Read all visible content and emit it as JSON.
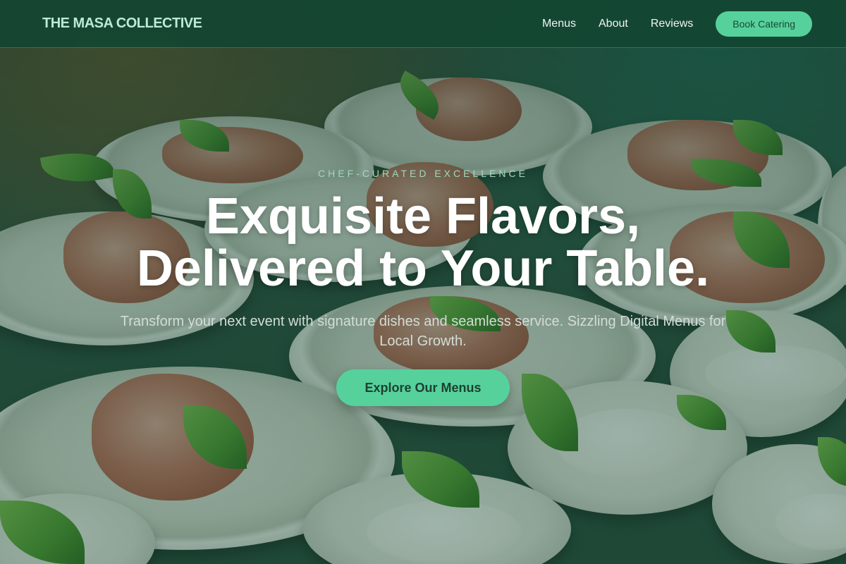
{
  "nav": {
    "brand": "THE MASA COLLECTIVE",
    "links": [
      "Menus",
      "About",
      "Reviews"
    ],
    "cta": "Book Catering"
  },
  "hero": {
    "eyebrow": "CHEF-CURATED EXCELLENCE",
    "headline_line1": "Exquisite Flavors,",
    "headline_line2": "Delivered to Your Table.",
    "subtitle": "Transform your next event with signature dishes and seamless service. Sizzling Digital Menus for Local Growth.",
    "cta": "Explore Our Menus"
  },
  "colors": {
    "accent": "#56d19c",
    "nav_bg": "#144632",
    "brand_text": "#b9ecd4",
    "eyebrow_text": "#9ed9bd"
  }
}
